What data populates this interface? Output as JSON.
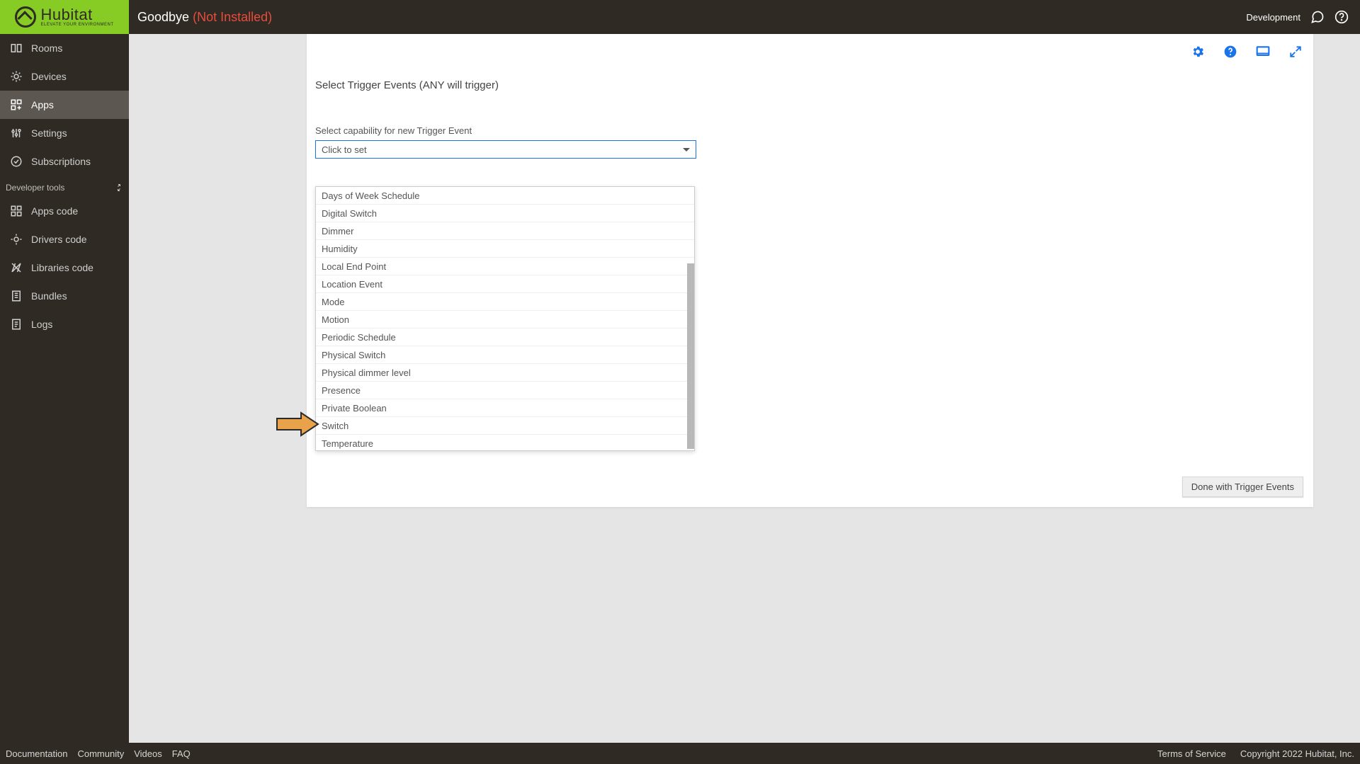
{
  "brand": {
    "name": "Hubitat",
    "tagline": "ELEVATE YOUR ENVIRONMENT"
  },
  "header": {
    "title": "Goodbye",
    "status": "(Not Installed)",
    "dev_label": "Development"
  },
  "sidebar": {
    "items": [
      {
        "label": "Rooms"
      },
      {
        "label": "Devices"
      },
      {
        "label": "Apps"
      },
      {
        "label": "Settings"
      },
      {
        "label": "Subscriptions"
      }
    ],
    "section_label": "Developer tools",
    "dev_items": [
      {
        "label": "Apps code"
      },
      {
        "label": "Drivers code"
      },
      {
        "label": "Libraries code"
      },
      {
        "label": "Bundles"
      },
      {
        "label": "Logs"
      }
    ]
  },
  "main": {
    "section_title": "Select Trigger Events (ANY will trigger)",
    "field_label": "Select capability for new Trigger Event",
    "select_placeholder": "Click to set",
    "dropdown_options": [
      "Days of Week Schedule",
      "Digital Switch",
      "Dimmer",
      "Humidity",
      "Local End Point",
      "Location Event",
      "Mode",
      "Motion",
      "Periodic Schedule",
      "Physical Switch",
      "Physical dimmer level",
      "Presence",
      "Private Boolean",
      "Switch",
      "Temperature"
    ],
    "done_label": "Done with Trigger Events"
  },
  "footer": {
    "links": [
      "Documentation",
      "Community",
      "Videos",
      "FAQ"
    ],
    "terms": "Terms of Service",
    "copyright": "Copyright 2022 Hubitat, Inc."
  }
}
